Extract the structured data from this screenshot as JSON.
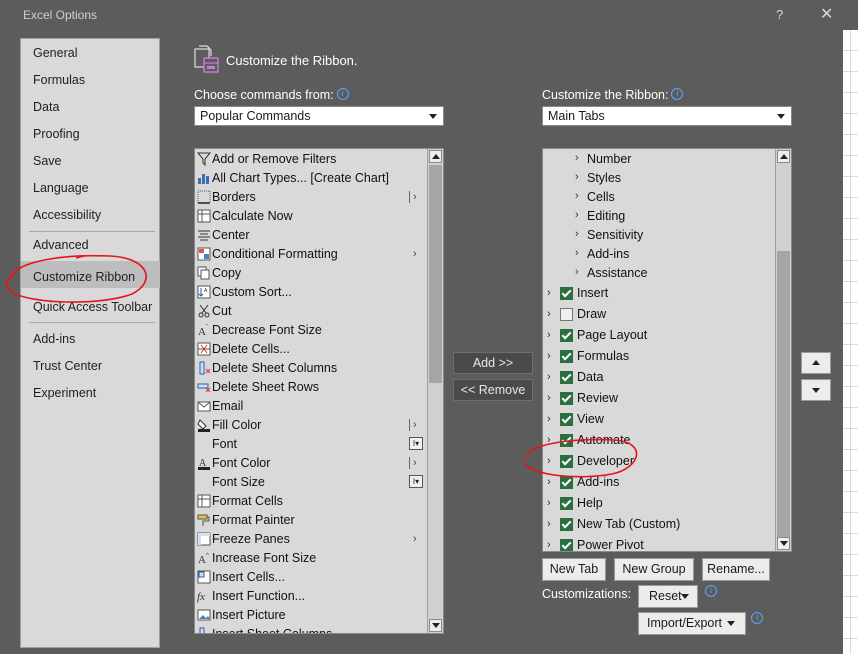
{
  "window": {
    "title": "Excel Options",
    "help_label": "?",
    "close_label": "✕"
  },
  "sidebar": {
    "items": [
      {
        "label": "General"
      },
      {
        "label": "Formulas"
      },
      {
        "label": "Data"
      },
      {
        "label": "Proofing"
      },
      {
        "label": "Save"
      },
      {
        "label": "Language"
      },
      {
        "label": "Accessibility"
      },
      {
        "label": "Advanced"
      },
      {
        "label": "Customize Ribbon",
        "selected": true
      },
      {
        "label": "Quick Access Toolbar"
      },
      {
        "label": "Add-ins"
      },
      {
        "label": "Trust Center"
      },
      {
        "label": "Experiment"
      }
    ]
  },
  "header": {
    "title": "Customize the Ribbon."
  },
  "left": {
    "label": "Choose commands from:",
    "dropdown_value": "Popular Commands",
    "commands": [
      {
        "label": "Add or Remove Filters",
        "icon": "filter-icon",
        "sub": ""
      },
      {
        "label": "All Chart Types... [Create Chart]",
        "icon": "chart-icon",
        "sub": ""
      },
      {
        "label": "Borders",
        "icon": "borders-icon",
        "sub": "bar"
      },
      {
        "label": "Calculate Now",
        "icon": "calculate-icon",
        "sub": ""
      },
      {
        "label": "Center",
        "icon": "center-align-icon",
        "sub": ""
      },
      {
        "label": "Conditional Formatting",
        "icon": "conditional-formatting-icon",
        "sub": "arrow"
      },
      {
        "label": "Copy",
        "icon": "copy-icon",
        "sub": ""
      },
      {
        "label": "Custom Sort...",
        "icon": "sort-icon",
        "sub": ""
      },
      {
        "label": "Cut",
        "icon": "scissors-icon",
        "sub": ""
      },
      {
        "label": "Decrease Font Size",
        "icon": "decrease-font-icon",
        "sub": ""
      },
      {
        "label": "Delete Cells...",
        "icon": "delete-cells-icon",
        "sub": ""
      },
      {
        "label": "Delete Sheet Columns",
        "icon": "delete-columns-icon",
        "sub": ""
      },
      {
        "label": "Delete Sheet Rows",
        "icon": "delete-rows-icon",
        "sub": ""
      },
      {
        "label": "Email",
        "icon": "email-icon",
        "sub": ""
      },
      {
        "label": "Fill Color",
        "icon": "fill-color-icon",
        "sub": "bar"
      },
      {
        "label": "Font",
        "icon": "",
        "sub": "box"
      },
      {
        "label": "Font Color",
        "icon": "font-color-icon",
        "sub": "bar"
      },
      {
        "label": "Font Size",
        "icon": "",
        "sub": "box"
      },
      {
        "label": "Format Cells",
        "icon": "format-cells-icon",
        "sub": ""
      },
      {
        "label": "Format Painter",
        "icon": "format-painter-icon",
        "sub": ""
      },
      {
        "label": "Freeze Panes",
        "icon": "freeze-panes-icon",
        "sub": "arrow"
      },
      {
        "label": "Increase Font Size",
        "icon": "increase-font-icon",
        "sub": ""
      },
      {
        "label": "Insert Cells...",
        "icon": "insert-cells-icon",
        "sub": ""
      },
      {
        "label": "Insert Function...",
        "icon": "function-icon",
        "sub": ""
      },
      {
        "label": "Insert Picture",
        "icon": "picture-icon",
        "sub": ""
      },
      {
        "label": "Insert Sheet Columns",
        "icon": "insert-columns-icon",
        "sub": ""
      }
    ]
  },
  "middle": {
    "add_label": "Add >>",
    "remove_label": "<< Remove"
  },
  "right": {
    "label": "Customize the Ribbon:",
    "dropdown_value": "Main Tabs",
    "groups": [
      {
        "label": "Number"
      },
      {
        "label": "Styles"
      },
      {
        "label": "Cells"
      },
      {
        "label": "Editing"
      },
      {
        "label": "Sensitivity"
      },
      {
        "label": "Add-ins"
      },
      {
        "label": "Assistance"
      }
    ],
    "tabs": [
      {
        "label": "Insert",
        "checked": true
      },
      {
        "label": "Draw",
        "checked": false
      },
      {
        "label": "Page Layout",
        "checked": true
      },
      {
        "label": "Formulas",
        "checked": true
      },
      {
        "label": "Data",
        "checked": true
      },
      {
        "label": "Review",
        "checked": true
      },
      {
        "label": "View",
        "checked": true
      },
      {
        "label": "Automate",
        "checked": true
      },
      {
        "label": "Developer",
        "checked": true
      },
      {
        "label": "Add-ins",
        "checked": true
      },
      {
        "label": "Help",
        "checked": true
      },
      {
        "label": "New Tab (Custom)",
        "checked": true
      },
      {
        "label": "Power Pivot",
        "checked": true
      }
    ],
    "new_tab_label": "New Tab",
    "new_group_label": "New Group",
    "rename_label": "Rename...",
    "customizations_label": "Customizations:",
    "reset_label": "Reset",
    "import_export_label": "Import/Export"
  }
}
